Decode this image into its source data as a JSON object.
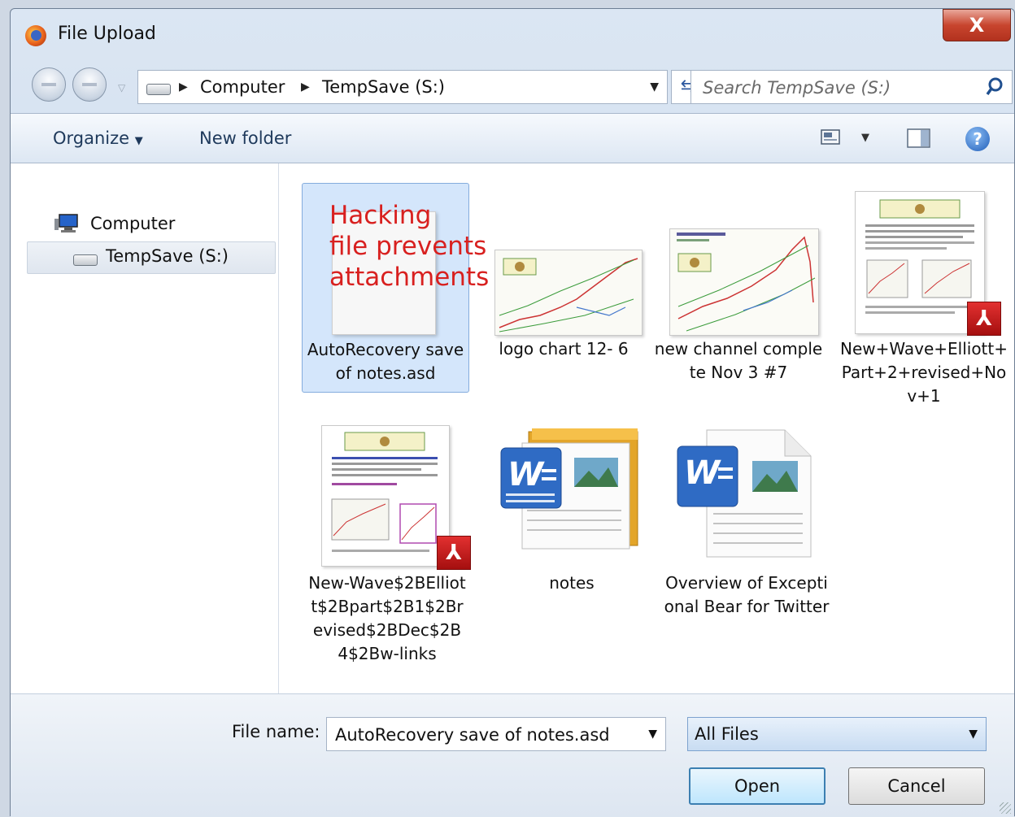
{
  "window": {
    "title": "File Upload",
    "close_label": "X"
  },
  "address": {
    "crumbs": [
      "Computer",
      "TempSave (S:)"
    ],
    "search_placeholder": "Search TempSave (S:)"
  },
  "toolbar": {
    "organize_label": "Organize",
    "new_folder_label": "New folder",
    "help_label": "?"
  },
  "nav": {
    "items": [
      {
        "label": "Computer",
        "icon": "computer-icon"
      },
      {
        "label": "TempSave (S:)",
        "icon": "drive-icon",
        "selected": true
      }
    ]
  },
  "files": [
    {
      "name": "AutoRecovery save of notes.asd",
      "overlay": "Hacking file prevents attachments",
      "selected": true,
      "kind": "asd"
    },
    {
      "name": "logo chart 12- 6",
      "kind": "image"
    },
    {
      "name": "new channel complete Nov 3 #7",
      "kind": "image"
    },
    {
      "name": "New+Wave+Elliott+Part+2+revised+Nov+1",
      "kind": "pdf"
    },
    {
      "name": "New-Wave$2BElliott$2Bpart$2B1$2Brevised$2BDec$2B4$2Bw-links",
      "kind": "pdf"
    },
    {
      "name": "notes",
      "kind": "word-folder"
    },
    {
      "name": "Overview of Exceptional Bear for Twitter",
      "kind": "word"
    }
  ],
  "bottom": {
    "filename_label": "File name:",
    "filename_value": "AutoRecovery save of notes.asd",
    "filter_value": "All Files",
    "open_label": "Open",
    "cancel_label": "Cancel"
  },
  "colors": {
    "overlay_text": "#d8201f",
    "selection": "#d4e6fb",
    "pdf_badge": "#c01818"
  }
}
